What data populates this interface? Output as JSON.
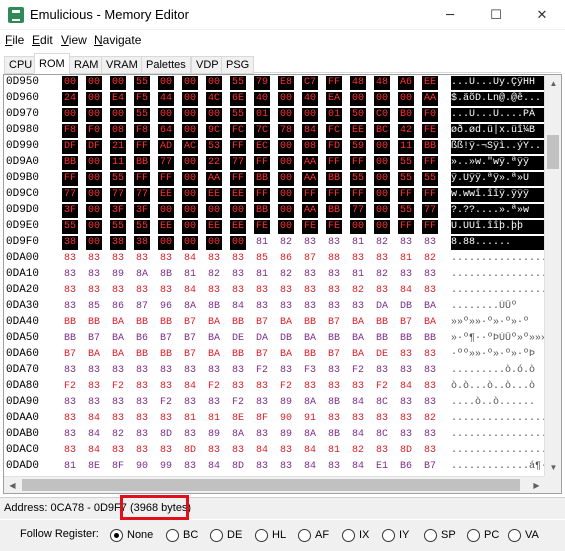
{
  "window": {
    "title": "Emulicious - Memory Editor",
    "minimize": "─",
    "maximize": "☐",
    "close": "✕"
  },
  "menu": [
    "File",
    "Edit",
    "View",
    "Navigate"
  ],
  "tabs": [
    "CPU",
    "ROM",
    "RAM",
    "VRAM",
    "Palettes",
    "VDP",
    "PSG"
  ],
  "active_tab": "ROM",
  "hex_rows": [
    {
      "addr": "0D950",
      "bytes": [
        "00",
        "00",
        "00",
        "55",
        "00",
        "00",
        "00",
        "55",
        "79",
        "E8",
        "C7",
        "FF",
        "48",
        "48",
        "A6",
        "EE"
      ],
      "ascii": "...U...Uy.ÇÿHH"
    },
    {
      "addr": "0D960",
      "bytes": [
        "24",
        "00",
        "E4",
        "F5",
        "44",
        "00",
        "4C",
        "6E",
        "40",
        "00",
        "40",
        "EA",
        "00",
        "00",
        "00",
        "AA"
      ],
      "ascii": "$.äõD.Ln@.@ê..."
    },
    {
      "addr": "0D970",
      "bytes": [
        "00",
        "00",
        "00",
        "55",
        "00",
        "00",
        "00",
        "55",
        "01",
        "00",
        "00",
        "01",
        "50",
        "C0",
        "B0",
        "F0"
      ],
      "ascii": "...U...U....PÀ"
    },
    {
      "addr": "0D980",
      "bytes": [
        "F8",
        "F0",
        "08",
        "F8",
        "64",
        "00",
        "9C",
        "FC",
        "7C",
        "78",
        "84",
        "FC",
        "EE",
        "BC",
        "42",
        "FE"
      ],
      "ascii": "øð.ød.ü|x.üî¼B"
    },
    {
      "addr": "0D990",
      "bytes": [
        "DF",
        "DF",
        "21",
        "FF",
        "AD",
        "AC",
        "53",
        "FF",
        "EC",
        "00",
        "08",
        "FD",
        "59",
        "00",
        "11",
        "BB"
      ],
      "ascii": "ßß!ÿ-¬Sÿì..ýY.."
    },
    {
      "addr": "0D9A0",
      "bytes": [
        "BB",
        "00",
        "11",
        "BB",
        "77",
        "00",
        "22",
        "77",
        "FF",
        "00",
        "AA",
        "FF",
        "FF",
        "00",
        "55",
        "FF"
      ],
      "ascii": "»..»w.\"wÿ.ªÿÿ"
    },
    {
      "addr": "0D9B0",
      "bytes": [
        "FF",
        "00",
        "55",
        "FF",
        "FF",
        "00",
        "AA",
        "FF",
        "BB",
        "00",
        "AA",
        "BB",
        "55",
        "00",
        "55",
        "55"
      ],
      "ascii": "ÿ.Uÿÿ.ªÿ».ª»U"
    },
    {
      "addr": "0D9C0",
      "bytes": [
        "77",
        "00",
        "77",
        "77",
        "EE",
        "00",
        "EE",
        "EE",
        "FF",
        "00",
        "FF",
        "FF",
        "FF",
        "00",
        "FF",
        "FF"
      ],
      "ascii": "w.wwî.îîÿ.ÿÿÿ"
    },
    {
      "addr": "0D9D0",
      "bytes": [
        "3F",
        "00",
        "3F",
        "3F",
        "00",
        "00",
        "00",
        "00",
        "BB",
        "00",
        "AA",
        "BB",
        "77",
        "00",
        "55",
        "77"
      ],
      "ascii": "?.??....».ª»w"
    },
    {
      "addr": "0D9E0",
      "bytes": [
        "55",
        "00",
        "55",
        "55",
        "EE",
        "00",
        "EE",
        "EE",
        "FE",
        "00",
        "FE",
        "FE",
        "00",
        "00",
        "FF",
        "FF"
      ],
      "ascii": "U.UUî.îîþ.þþ"
    },
    {
      "addr": "0D9F0",
      "bytes": [
        "38",
        "00",
        "38",
        "38",
        "00",
        "00",
        "00",
        "00",
        "81",
        "82",
        "83",
        "83",
        "81",
        "82",
        "83",
        "83"
      ],
      "ascii": "8.88......"
    },
    {
      "addr": "0DA00",
      "bytes": [
        "83",
        "83",
        "83",
        "83",
        "83",
        "84",
        "83",
        "83",
        "85",
        "86",
        "87",
        "88",
        "83",
        "83",
        "81",
        "82"
      ],
      "ascii": "................"
    },
    {
      "addr": "0DA10",
      "bytes": [
        "83",
        "83",
        "89",
        "8A",
        "8B",
        "81",
        "82",
        "83",
        "81",
        "82",
        "83",
        "83",
        "81",
        "82",
        "83",
        "83"
      ],
      "ascii": "................"
    },
    {
      "addr": "0DA20",
      "bytes": [
        "83",
        "83",
        "83",
        "83",
        "83",
        "84",
        "83",
        "83",
        "83",
        "83",
        "83",
        "83",
        "82",
        "83",
        "84",
        "83"
      ],
      "ascii": "................"
    },
    {
      "addr": "0DA30",
      "bytes": [
        "83",
        "85",
        "86",
        "87",
        "96",
        "8A",
        "8B",
        "84",
        "83",
        "83",
        "83",
        "83",
        "83",
        "DA",
        "DB",
        "BA"
      ],
      "ascii": "........ÚÛº"
    },
    {
      "addr": "0DA40",
      "bytes": [
        "BB",
        "BB",
        "BA",
        "BB",
        "BB",
        "B7",
        "BA",
        "BB",
        "B7",
        "BA",
        "BB",
        "B7",
        "BA",
        "BB",
        "B7",
        "BA"
      ],
      "ascii": "»»º»»·º»·º»·º"
    },
    {
      "addr": "0DA50",
      "bytes": [
        "BB",
        "B7",
        "BA",
        "B6",
        "B7",
        "B7",
        "BA",
        "DE",
        "DA",
        "DB",
        "BA",
        "BB",
        "BA",
        "BB",
        "BB",
        "BB"
      ],
      "ascii": "»·º¶··ºÞÚÛº»º»»»"
    },
    {
      "addr": "0DA60",
      "bytes": [
        "B7",
        "BA",
        "BA",
        "BB",
        "BB",
        "B7",
        "BA",
        "BB",
        "B7",
        "BA",
        "BB",
        "B7",
        "BA",
        "DE",
        "83",
        "83"
      ],
      "ascii": "·ºº»»·º»·º»·ºÞ"
    },
    {
      "addr": "0DA70",
      "bytes": [
        "83",
        "83",
        "83",
        "83",
        "83",
        "83",
        "83",
        "83",
        "F2",
        "83",
        "F3",
        "83",
        "F2",
        "83",
        "83",
        "83"
      ],
      "ascii": ".........ò.ó.ò"
    },
    {
      "addr": "0DA80",
      "bytes": [
        "F2",
        "83",
        "F2",
        "83",
        "83",
        "84",
        "F2",
        "83",
        "83",
        "F2",
        "83",
        "83",
        "83",
        "F2",
        "84",
        "83"
      ],
      "ascii": "ò.ò...ò..ò...ò"
    },
    {
      "addr": "0DA90",
      "bytes": [
        "83",
        "83",
        "83",
        "83",
        "F2",
        "83",
        "83",
        "F2",
        "83",
        "89",
        "8A",
        "8B",
        "84",
        "8C",
        "83",
        "83"
      ],
      "ascii": "....ò..ò......"
    },
    {
      "addr": "0DAA0",
      "bytes": [
        "83",
        "84",
        "83",
        "83",
        "83",
        "81",
        "81",
        "8E",
        "8F",
        "90",
        "91",
        "83",
        "83",
        "83",
        "83",
        "82"
      ],
      "ascii": "................"
    },
    {
      "addr": "0DAB0",
      "bytes": [
        "83",
        "84",
        "82",
        "83",
        "8D",
        "83",
        "89",
        "8A",
        "83",
        "89",
        "8A",
        "8B",
        "84",
        "8C",
        "83",
        "83"
      ],
      "ascii": "................"
    },
    {
      "addr": "0DAC0",
      "bytes": [
        "83",
        "84",
        "83",
        "83",
        "83",
        "8D",
        "83",
        "83",
        "84",
        "83",
        "84",
        "81",
        "82",
        "83",
        "8D",
        "83"
      ],
      "ascii": "................"
    },
    {
      "addr": "0DAD0",
      "bytes": [
        "81",
        "8E",
        "8F",
        "90",
        "99",
        "83",
        "84",
        "8D",
        "83",
        "83",
        "84",
        "83",
        "84",
        "E1",
        "B6",
        "B7"
      ],
      "ascii": ".............á¶·"
    }
  ],
  "status": {
    "address_text": "Address: 0CA78 - 0D9F7",
    "bytes_text": "(3968 bytes)"
  },
  "follow": {
    "label": "Follow Register:",
    "options": [
      "None",
      "BC",
      "DE",
      "HL",
      "AF",
      "IX",
      "IY",
      "SP",
      "PC",
      "VA"
    ],
    "selected": "None"
  },
  "colors": {
    "selected_bg": "#000000",
    "selected_text": "#ff3030",
    "purple": "#7a2d8c",
    "red": "#d81e2a",
    "highlight": "#e0101a"
  }
}
